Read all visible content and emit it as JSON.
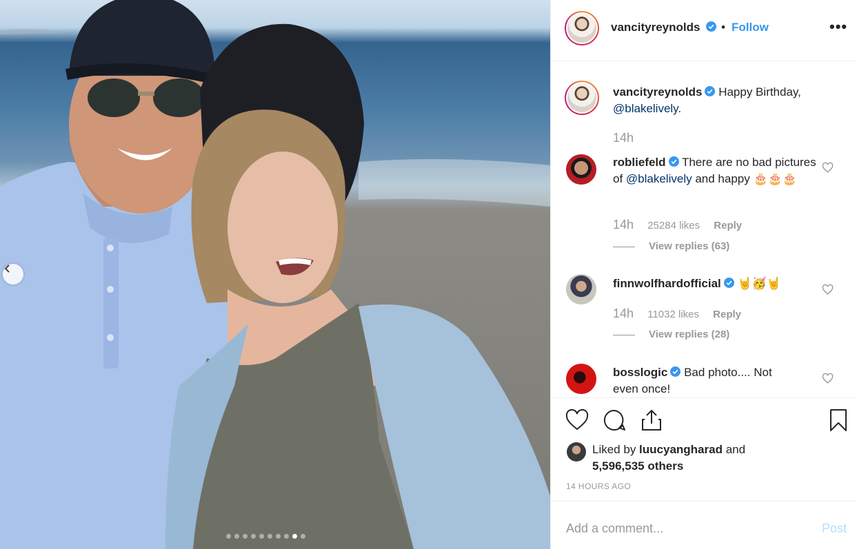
{
  "post": {
    "username": "vancityreynolds",
    "follow_label": "Follow",
    "separator": "•",
    "more_label": "•••",
    "carousel": {
      "slide_count": 10,
      "active_index": 8
    }
  },
  "caption": {
    "username": "vancityreynolds",
    "text": "Happy Birthday,",
    "mention": "@blakelively",
    "suffix": ".",
    "time": "14h"
  },
  "comments": [
    {
      "username": "robliefeld",
      "text_before": "There are no bad pictures of ",
      "mention": "@blakelively",
      "text_after": " and happy ",
      "emoji": "🎂🎂🎂",
      "time": "14h",
      "likes": "25284 likes",
      "reply_label": "Reply",
      "view_replies": "View replies (63)"
    },
    {
      "username": "finnwolfhardofficial",
      "emoji": "🤘🥳🤘",
      "time": "14h",
      "likes": "11032 likes",
      "reply_label": "Reply",
      "view_replies": "View replies (28)"
    },
    {
      "username": "bosslogic",
      "text": "Bad photo.... Not even once!"
    }
  ],
  "likes": {
    "prefix": "Liked by ",
    "user": "luucyangharad",
    "middle": " and",
    "count": "5,596,535 others"
  },
  "timestamp": "14 HOURS AGO",
  "add_comment": {
    "placeholder": "Add a comment...",
    "post_label": "Post"
  },
  "colors": {
    "link_blue": "#3897f0",
    "mention_blue": "#003569",
    "verified_blue": "#3897f0",
    "post_disabled": "#b2dffc"
  }
}
